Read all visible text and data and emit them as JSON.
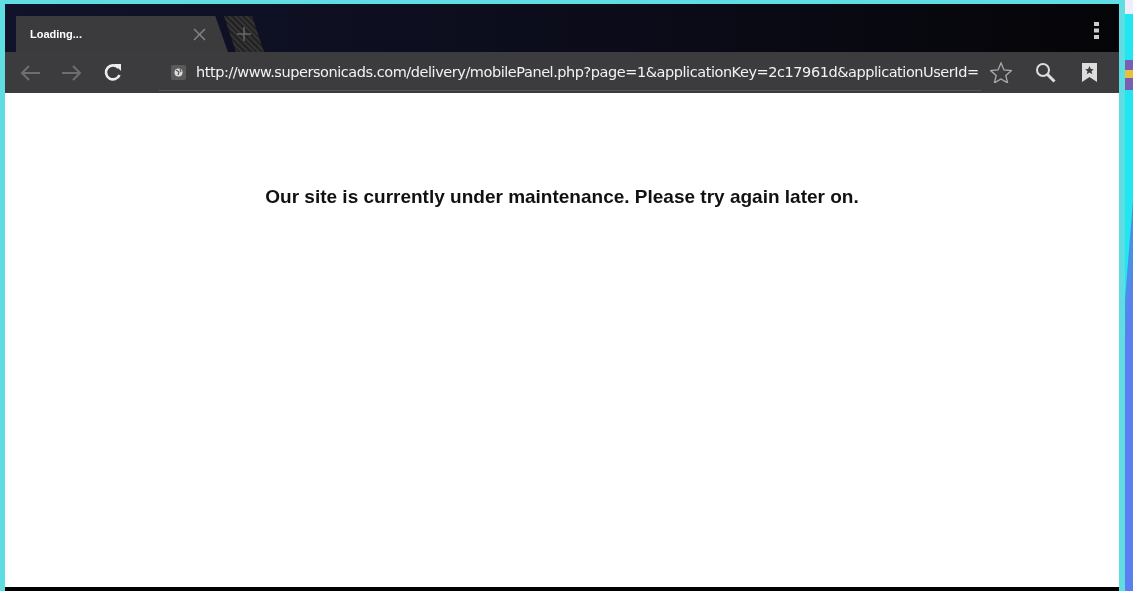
{
  "tabs": [
    {
      "title": "Loading...",
      "selected": true
    }
  ],
  "toolbar": {
    "back_disabled": true,
    "forward_disabled": true,
    "url": "http://www.supersonicads.com/delivery/mobilePanel.php?page=1&applicationKey=2c17961d&applicationUserId="
  },
  "page": {
    "message": "Our site is currently under maintenance. Please try again later on."
  }
}
